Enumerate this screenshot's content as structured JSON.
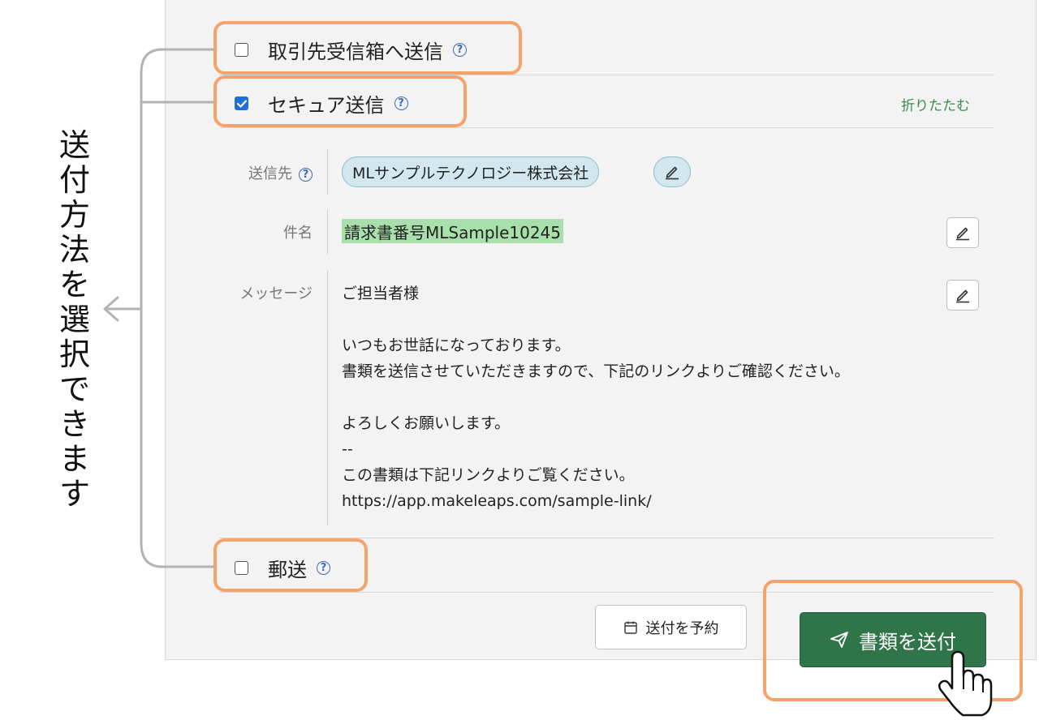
{
  "annotation": {
    "text": "送付方法を選択できます"
  },
  "options": {
    "inbox": {
      "label": "取引先受信箱へ送信",
      "checked": false
    },
    "secure": {
      "label": "セキュア送信",
      "checked": true
    },
    "postal": {
      "label": "郵送",
      "checked": false
    }
  },
  "collapse_label": "折りたたむ",
  "help_glyph": "?",
  "fields": {
    "recipient_label": "送信先",
    "recipient_value": "MLサンプルテクノロジー株式会社",
    "subject_label": "件名",
    "subject_value": "請求書番号MLSample10245",
    "message_label": "メッセージ",
    "message_lines": [
      "ご担当者様",
      "",
      "いつもお世話になっております。",
      "書類を送信させていただきますので、下記のリンクよりご確認ください。",
      "",
      "よろしくお願いします。",
      "--",
      "この書類は下記リンクよりご覧ください。",
      "https://app.makeleaps.com/sample-link/"
    ]
  },
  "buttons": {
    "schedule": "送付を予約",
    "send": "書類を送付"
  },
  "colors": {
    "highlight": "#f4a36a",
    "send_button": "#2f7549",
    "link_green": "#3a8c4e",
    "chip_bg": "#d2e8ee",
    "subject_highlight": "#a8e0ac",
    "help_blue": "#3e6bb8"
  },
  "icons": {
    "help": "question-circle-icon",
    "edit": "pencil-icon",
    "calendar": "calendar-icon",
    "send": "paper-plane-icon",
    "cursor": "hand-pointer-icon",
    "annotation_arrow": "arrow-left-icon"
  }
}
